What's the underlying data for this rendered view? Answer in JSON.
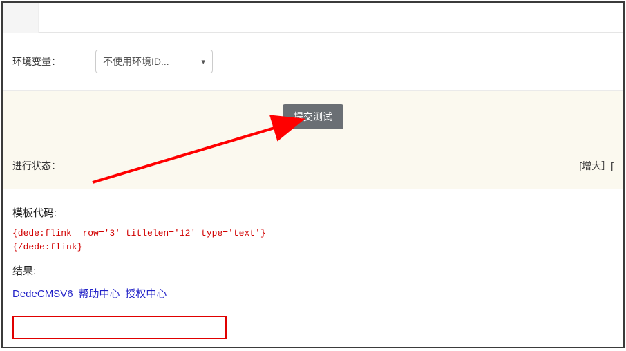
{
  "env": {
    "label": "环境变量：",
    "select_value": "不使用环境ID..."
  },
  "submit": {
    "button_label": "提交测试"
  },
  "status": {
    "label": "进行状态：",
    "right_action": "[增大］["
  },
  "template": {
    "title": "模板代码:",
    "code": "{dede:flink  row='3' titlelen='12' type='text'}\n{/dede:flink}"
  },
  "result": {
    "title": "结果:",
    "links": [
      {
        "text": "DedeCMSV6"
      },
      {
        "text": "帮助中心"
      },
      {
        "text": "授权中心"
      }
    ]
  },
  "annotations": {
    "arrow_color": "#ff0000",
    "box_color": "#e00000"
  }
}
